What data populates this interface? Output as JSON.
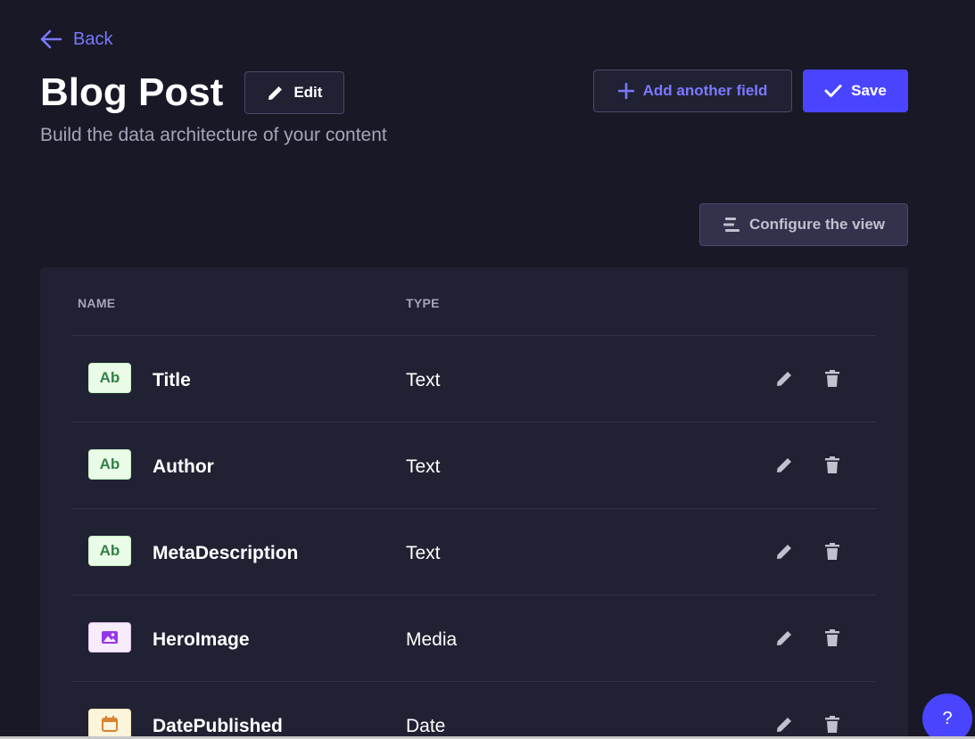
{
  "nav": {
    "back_label": "Back"
  },
  "header": {
    "title": "Blog Post",
    "edit_label": "Edit",
    "subtitle": "Build the data architecture of your content",
    "add_field_label": "Add another field",
    "save_label": "Save"
  },
  "toolbar": {
    "configure_label": "Configure the view"
  },
  "table": {
    "columns": {
      "name": "NAME",
      "type": "TYPE"
    },
    "rows": [
      {
        "name": "Title",
        "type": "Text",
        "icon": "text-type-icon",
        "icon_text": "Ab"
      },
      {
        "name": "Author",
        "type": "Text",
        "icon": "text-type-icon",
        "icon_text": "Ab"
      },
      {
        "name": "MetaDescription",
        "type": "Text",
        "icon": "text-type-icon",
        "icon_text": "Ab"
      },
      {
        "name": "HeroImage",
        "type": "Media",
        "icon": "media-type-icon",
        "icon_text": ""
      },
      {
        "name": "DatePublished",
        "type": "Date",
        "icon": "date-type-icon",
        "icon_text": ""
      }
    ]
  },
  "help": {
    "label": "?"
  },
  "colors": {
    "background": "#181826",
    "card": "#212134",
    "primary": "#4945ff",
    "accent_text": "#7b79ff",
    "text_type": "#328048",
    "media_type": "#9736e8",
    "date_type": "#d9822f"
  }
}
